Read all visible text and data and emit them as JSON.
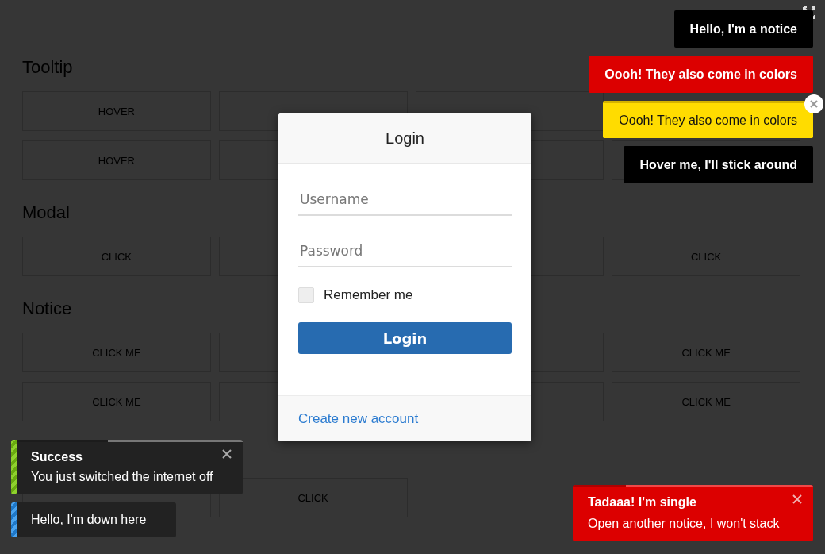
{
  "sections": [
    {
      "title": "Tooltip",
      "rows": [
        [
          {
            "label": "HOVER"
          },
          {},
          {},
          {}
        ],
        [
          {
            "label": "HOVER"
          },
          {},
          {},
          {}
        ]
      ]
    },
    {
      "title": "Modal",
      "rows": [
        [
          {
            "label": "CLICK"
          },
          {},
          {},
          {
            "label": "CLICK"
          }
        ]
      ]
    },
    {
      "title": "Notice",
      "rows": [
        [
          {
            "label": "CLICK ME"
          },
          {},
          {},
          {
            "label": "CLICK ME"
          }
        ],
        [
          {
            "label": "CLICK ME"
          },
          {},
          {},
          {
            "label": "CLICK ME"
          }
        ]
      ]
    },
    {
      "rows": [
        [
          {},
          {
            "label": "CLICK"
          }
        ]
      ]
    }
  ],
  "top_notices": [
    {
      "text": "Hello, I'm a notice",
      "kind": "black"
    },
    {
      "text": "Oooh! They also come in colors",
      "kind": "red"
    },
    {
      "text": "Oooh! They also come in colors",
      "kind": "yellow",
      "closable": true
    },
    {
      "text": "Hover me, I'll stick around",
      "kind": "black"
    }
  ],
  "modal": {
    "title": "Login",
    "fields": [
      {
        "placeholder": "Username"
      },
      {
        "placeholder": "Password"
      }
    ],
    "remember": {
      "label": "Remember me",
      "checked": false
    },
    "submit": "Login",
    "footer_link": "Create new account"
  },
  "bottom_left_notices": [
    {
      "title": "Success",
      "text": "You just switched the internet off",
      "kind": "success",
      "level": 0.6,
      "closable": true
    },
    {
      "text": "Hello, I'm down here",
      "kind": "info"
    }
  ],
  "bottom_right_notice": {
    "title": "Tadaaa! I'm single",
    "text": "Open another notice, I won't stack",
    "kind": "red",
    "level": 0.78,
    "closable": true
  }
}
